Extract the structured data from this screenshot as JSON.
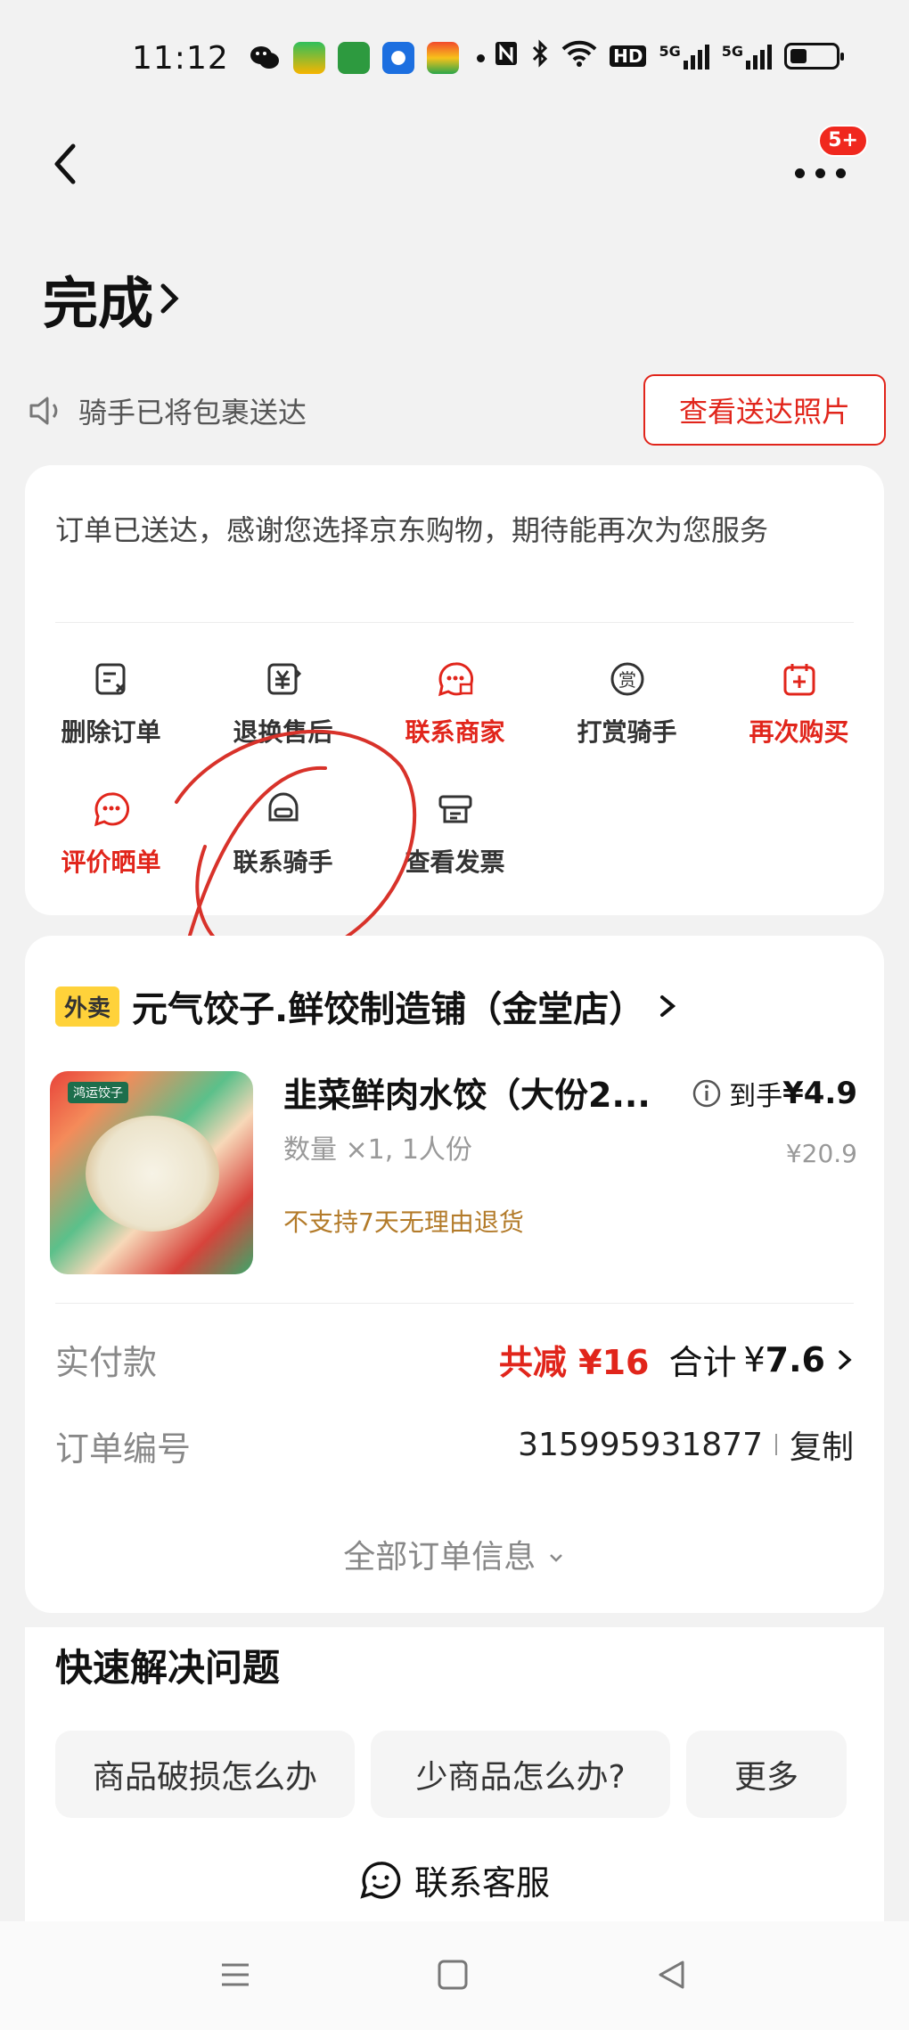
{
  "status_bar": {
    "time": "11:12",
    "network": "5G",
    "hd": "HD"
  },
  "header": {
    "badge": "5+"
  },
  "order_status": {
    "title": "完成"
  },
  "delivery_notice": {
    "text": "骑手已将包裹送达",
    "photo_button": "查看送达照片"
  },
  "thanks_message": "订单已送达，感谢您选择京东购物，期待能再次为您服务",
  "actions": [
    {
      "label": "删除订单",
      "icon": "delete-order-icon",
      "highlight": false
    },
    {
      "label": "退换售后",
      "icon": "refund-icon",
      "highlight": false
    },
    {
      "label": "联系商家",
      "icon": "contact-merchant-icon",
      "highlight": true
    },
    {
      "label": "打赏骑手",
      "icon": "tip-rider-icon",
      "highlight": false
    },
    {
      "label": "再次购买",
      "icon": "rebuy-icon",
      "highlight": true
    },
    {
      "label": "评价晒单",
      "icon": "review-icon",
      "highlight": true
    },
    {
      "label": "联系骑手",
      "icon": "contact-rider-icon",
      "highlight": false
    },
    {
      "label": "查看发票",
      "icon": "invoice-icon",
      "highlight": false
    }
  ],
  "shop": {
    "tag": "外卖",
    "name": "元气饺子.鲜饺制造铺（金堂店）"
  },
  "product": {
    "name": "韭菜鲜肉水饺（大份2...",
    "quantity": "数量 ×1, 1人份",
    "return_policy": "不支持7天无理由退货",
    "final_price_label": "到手",
    "final_price_symbol": "¥",
    "final_price": "4.9",
    "original_price": "¥20.9",
    "image_label": "鸿运饺子"
  },
  "payment": {
    "label": "实付款",
    "discount": "共减 ¥16",
    "total_label": "合计",
    "total_symbol": "¥",
    "total": "7.6"
  },
  "order_number": {
    "label": "订单编号",
    "value": "315995931877",
    "copy": "复制"
  },
  "all_info": "全部订单信息",
  "quick_solve": {
    "title": "快速解决问题",
    "chips": [
      "商品破损怎么办",
      "少商品怎么办?",
      "更多"
    ],
    "customer_service": "联系客服"
  },
  "colors": {
    "accent": "#e1251b",
    "tag": "#ffd23a",
    "annotation": "#d8322a"
  }
}
